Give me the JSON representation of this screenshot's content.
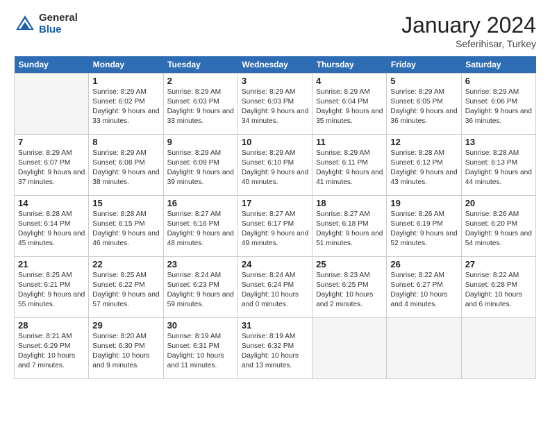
{
  "logo": {
    "general": "General",
    "blue": "Blue"
  },
  "title": "January 2024",
  "subtitle": "Seferihisar, Turkey",
  "weekdays": [
    "Sunday",
    "Monday",
    "Tuesday",
    "Wednesday",
    "Thursday",
    "Friday",
    "Saturday"
  ],
  "weeks": [
    [
      {
        "day": null
      },
      {
        "day": "1",
        "sunrise": "8:29 AM",
        "sunset": "6:02 PM",
        "daylight": "9 hours and 33 minutes."
      },
      {
        "day": "2",
        "sunrise": "8:29 AM",
        "sunset": "6:03 PM",
        "daylight": "9 hours and 33 minutes."
      },
      {
        "day": "3",
        "sunrise": "8:29 AM",
        "sunset": "6:03 PM",
        "daylight": "9 hours and 34 minutes."
      },
      {
        "day": "4",
        "sunrise": "8:29 AM",
        "sunset": "6:04 PM",
        "daylight": "9 hours and 35 minutes."
      },
      {
        "day": "5",
        "sunrise": "8:29 AM",
        "sunset": "6:05 PM",
        "daylight": "9 hours and 36 minutes."
      },
      {
        "day": "6",
        "sunrise": "8:29 AM",
        "sunset": "6:06 PM",
        "daylight": "9 hours and 36 minutes."
      }
    ],
    [
      {
        "day": "7",
        "sunrise": "8:29 AM",
        "sunset": "6:07 PM",
        "daylight": "9 hours and 37 minutes."
      },
      {
        "day": "8",
        "sunrise": "8:29 AM",
        "sunset": "6:08 PM",
        "daylight": "9 hours and 38 minutes."
      },
      {
        "day": "9",
        "sunrise": "8:29 AM",
        "sunset": "6:09 PM",
        "daylight": "9 hours and 39 minutes."
      },
      {
        "day": "10",
        "sunrise": "8:29 AM",
        "sunset": "6:10 PM",
        "daylight": "9 hours and 40 minutes."
      },
      {
        "day": "11",
        "sunrise": "8:29 AM",
        "sunset": "6:11 PM",
        "daylight": "9 hours and 41 minutes."
      },
      {
        "day": "12",
        "sunrise": "8:28 AM",
        "sunset": "6:12 PM",
        "daylight": "9 hours and 43 minutes."
      },
      {
        "day": "13",
        "sunrise": "8:28 AM",
        "sunset": "6:13 PM",
        "daylight": "9 hours and 44 minutes."
      }
    ],
    [
      {
        "day": "14",
        "sunrise": "8:28 AM",
        "sunset": "6:14 PM",
        "daylight": "9 hours and 45 minutes."
      },
      {
        "day": "15",
        "sunrise": "8:28 AM",
        "sunset": "6:15 PM",
        "daylight": "9 hours and 46 minutes."
      },
      {
        "day": "16",
        "sunrise": "8:27 AM",
        "sunset": "6:16 PM",
        "daylight": "9 hours and 48 minutes."
      },
      {
        "day": "17",
        "sunrise": "8:27 AM",
        "sunset": "6:17 PM",
        "daylight": "9 hours and 49 minutes."
      },
      {
        "day": "18",
        "sunrise": "8:27 AM",
        "sunset": "6:18 PM",
        "daylight": "9 hours and 51 minutes."
      },
      {
        "day": "19",
        "sunrise": "8:26 AM",
        "sunset": "6:19 PM",
        "daylight": "9 hours and 52 minutes."
      },
      {
        "day": "20",
        "sunrise": "8:26 AM",
        "sunset": "6:20 PM",
        "daylight": "9 hours and 54 minutes."
      }
    ],
    [
      {
        "day": "21",
        "sunrise": "8:25 AM",
        "sunset": "6:21 PM",
        "daylight": "9 hours and 55 minutes."
      },
      {
        "day": "22",
        "sunrise": "8:25 AM",
        "sunset": "6:22 PM",
        "daylight": "9 hours and 57 minutes."
      },
      {
        "day": "23",
        "sunrise": "8:24 AM",
        "sunset": "6:23 PM",
        "daylight": "9 hours and 59 minutes."
      },
      {
        "day": "24",
        "sunrise": "8:24 AM",
        "sunset": "6:24 PM",
        "daylight": "10 hours and 0 minutes."
      },
      {
        "day": "25",
        "sunrise": "8:23 AM",
        "sunset": "6:25 PM",
        "daylight": "10 hours and 2 minutes."
      },
      {
        "day": "26",
        "sunrise": "8:22 AM",
        "sunset": "6:27 PM",
        "daylight": "10 hours and 4 minutes."
      },
      {
        "day": "27",
        "sunrise": "8:22 AM",
        "sunset": "6:28 PM",
        "daylight": "10 hours and 6 minutes."
      }
    ],
    [
      {
        "day": "28",
        "sunrise": "8:21 AM",
        "sunset": "6:29 PM",
        "daylight": "10 hours and 7 minutes."
      },
      {
        "day": "29",
        "sunrise": "8:20 AM",
        "sunset": "6:30 PM",
        "daylight": "10 hours and 9 minutes."
      },
      {
        "day": "30",
        "sunrise": "8:19 AM",
        "sunset": "6:31 PM",
        "daylight": "10 hours and 11 minutes."
      },
      {
        "day": "31",
        "sunrise": "8:19 AM",
        "sunset": "6:32 PM",
        "daylight": "10 hours and 13 minutes."
      },
      {
        "day": null
      },
      {
        "day": null
      },
      {
        "day": null
      }
    ]
  ],
  "labels": {
    "sunrise": "Sunrise:",
    "sunset": "Sunset:",
    "daylight": "Daylight:"
  }
}
